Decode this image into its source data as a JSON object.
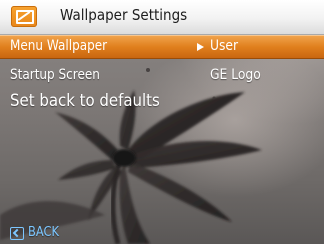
{
  "header": {
    "title": "Wallpaper Settings",
    "icon": "wallpaper-settings-icon"
  },
  "menu": {
    "items": [
      {
        "label": "Menu Wallpaper",
        "value": "User",
        "selected": true
      },
      {
        "label": "Startup Screen",
        "value": "GE Logo",
        "selected": false
      },
      {
        "label": "Set back to defaults",
        "value": "",
        "selected": false
      }
    ]
  },
  "footer": {
    "back_label": "BACK",
    "back_icon": "back-arrow-icon"
  },
  "colors": {
    "selection": "#e07f1d",
    "header_icon": "#f09a2a",
    "back": "#7cc6ff"
  }
}
